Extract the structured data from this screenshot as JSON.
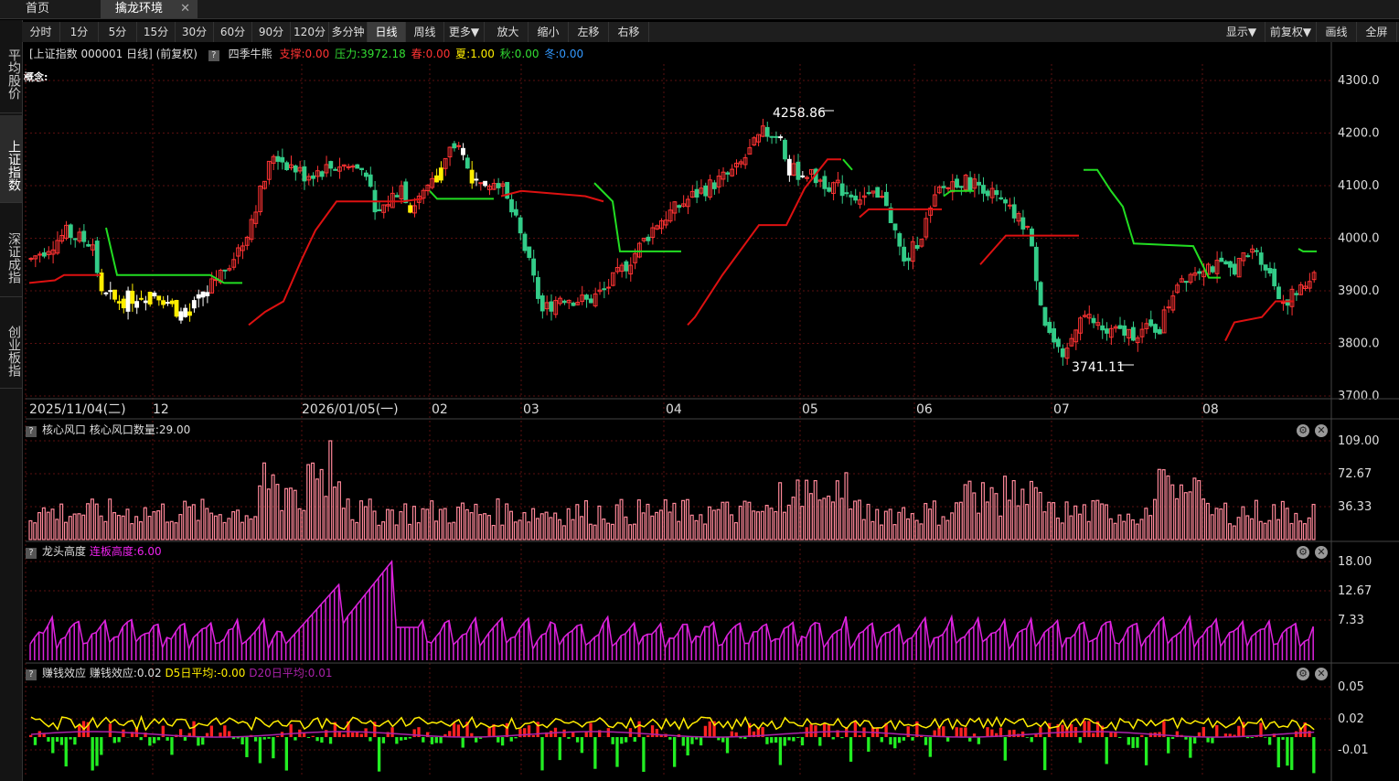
{
  "tabs": {
    "home": "首页",
    "active": "擒龙环境",
    "close": "✕"
  },
  "sidebar": [
    "平均股价",
    "上证指数",
    "深证成指",
    "创业板指"
  ],
  "toolbar": {
    "periods": [
      "分时",
      "1分",
      "5分",
      "15分",
      "30分",
      "60分",
      "90分",
      "120分",
      "多分钟",
      "日线",
      "周线",
      "更多▼"
    ],
    "actions": [
      "放大",
      "缩小",
      "左移",
      "右移"
    ],
    "right": [
      "显示▼",
      "前复权▼",
      "画线",
      "全屏"
    ],
    "active": "日线"
  },
  "info": {
    "title": "[上证指数 000001 日线] (前复权)",
    "qm": "?",
    "indicator": "四季牛熊",
    "support": "支撑:0.00",
    "pressure": "压力:3972.18",
    "spring": "春:0.00",
    "summer": "夏:1.00",
    "autumn": "秋:0.00",
    "winter": "冬:0.00"
  },
  "concept": "概念:",
  "main_chart": {
    "y_ticks": [
      "4300.0",
      "4200.0",
      "4100.0",
      "4000.0",
      "3900.0",
      "3800.0",
      "3700.0"
    ],
    "y_values": [
      4300,
      4200,
      4100,
      4000,
      3900,
      3800,
      3700
    ],
    "high_label": "4258.86",
    "low_label": "3741.11",
    "date_labels": [
      "2025/11/04(二)",
      "12",
      "2026/01/05(一)",
      "02",
      "03",
      "04",
      "05",
      "06",
      "07",
      "08"
    ]
  },
  "panels": [
    {
      "title": "核心风口",
      "value": "核心风口数量:29.00",
      "ticks": [
        "109.00",
        "72.67",
        "36.33"
      ]
    },
    {
      "title": "龙头高度",
      "value": "连板高度:6.00",
      "ticks": [
        "18.00",
        "12.67",
        "7.33"
      ]
    },
    {
      "title": "赚钱效应",
      "value": "赚钱效应:0.02",
      "d5": "D5日平均:-0.00",
      "d20": "D20日平均:0.01",
      "ticks": [
        "0.05",
        "0.02",
        "-0.01"
      ]
    }
  ],
  "colors": {
    "up": "#ff3333",
    "down": "#33cc88",
    "yellow": "#ffee00",
    "support_line": "#dd1111",
    "pressure_line": "#22dd22",
    "magenta": "#dd22dd",
    "bar_pink": "#ff8899"
  },
  "chart_data": {
    "type": "candlestick",
    "ylim": [
      3700,
      4300
    ],
    "high": 4258.86,
    "low": 3741.11
  }
}
